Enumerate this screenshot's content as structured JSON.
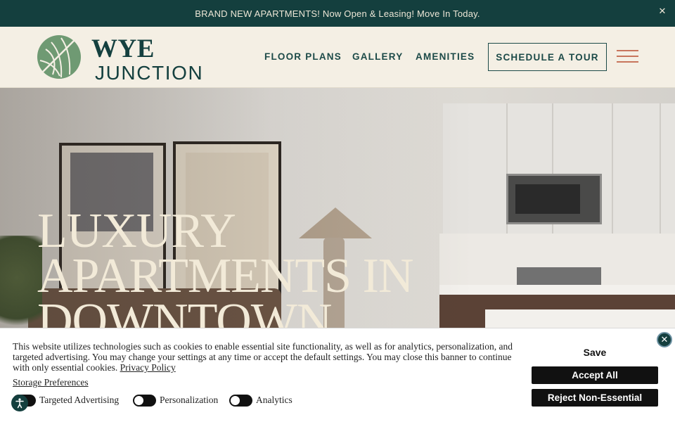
{
  "announcement": {
    "text": "BRAND NEW APARTMENTS! Now Open & Leasing! Move In Today.",
    "close_glyph": "✕",
    "close_icon": "close-icon"
  },
  "header": {
    "logo": {
      "line1": "WYE",
      "line2": "JUNCTION",
      "mark_icon": "leaf-logo-icon"
    },
    "nav": [
      "FLOOR PLANS",
      "GALLERY",
      "AMENITIES"
    ],
    "cta": "SCHEDULE A TOUR",
    "menu_icon": "hamburger-menu-icon"
  },
  "hero": {
    "title_lines": [
      "LUXURY",
      "APARTMENTS IN",
      "DOWNTOWN"
    ]
  },
  "cookie_banner": {
    "text": "This website utilizes technologies such as cookies to enable essential site functionality, as well as for analytics, personalization, and targeted advertising. You may change your settings at any time or accept the default settings. You may close this banner to continue with only essential cookies.",
    "privacy_link": "Privacy Policy",
    "storage_link": "Storage Preferences",
    "toggles": [
      "Targeted Advertising",
      "Personalization",
      "Analytics"
    ],
    "save": "Save",
    "accept": "Accept All",
    "reject": "Reject Non-Essential",
    "close_glyph": "✕"
  },
  "accessibility": {
    "icon": "accessibility-icon"
  },
  "colors": {
    "brand_dark": "#143f3e",
    "cream": "#f4efe4",
    "accent": "#c8755c"
  }
}
